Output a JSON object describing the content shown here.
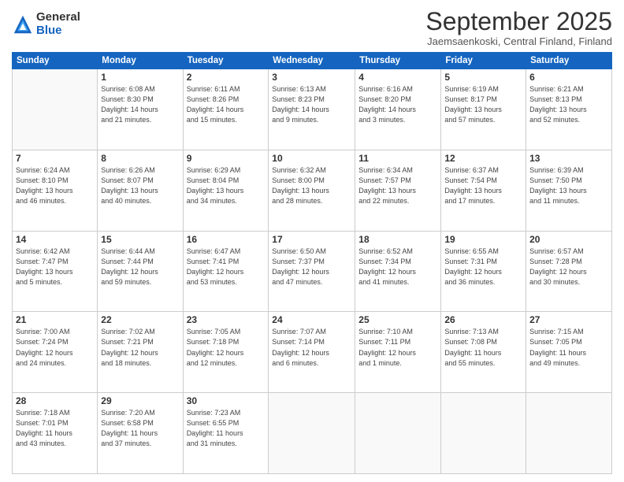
{
  "logo": {
    "general": "General",
    "blue": "Blue"
  },
  "header": {
    "month": "September 2025",
    "location": "Jaemsaenkoski, Central Finland, Finland"
  },
  "weekdays": [
    "Sunday",
    "Monday",
    "Tuesday",
    "Wednesday",
    "Thursday",
    "Friday",
    "Saturday"
  ],
  "weeks": [
    [
      {
        "day": "",
        "info": ""
      },
      {
        "day": "1",
        "info": "Sunrise: 6:08 AM\nSunset: 8:30 PM\nDaylight: 14 hours\nand 21 minutes."
      },
      {
        "day": "2",
        "info": "Sunrise: 6:11 AM\nSunset: 8:26 PM\nDaylight: 14 hours\nand 15 minutes."
      },
      {
        "day": "3",
        "info": "Sunrise: 6:13 AM\nSunset: 8:23 PM\nDaylight: 14 hours\nand 9 minutes."
      },
      {
        "day": "4",
        "info": "Sunrise: 6:16 AM\nSunset: 8:20 PM\nDaylight: 14 hours\nand 3 minutes."
      },
      {
        "day": "5",
        "info": "Sunrise: 6:19 AM\nSunset: 8:17 PM\nDaylight: 13 hours\nand 57 minutes."
      },
      {
        "day": "6",
        "info": "Sunrise: 6:21 AM\nSunset: 8:13 PM\nDaylight: 13 hours\nand 52 minutes."
      }
    ],
    [
      {
        "day": "7",
        "info": "Sunrise: 6:24 AM\nSunset: 8:10 PM\nDaylight: 13 hours\nand 46 minutes."
      },
      {
        "day": "8",
        "info": "Sunrise: 6:26 AM\nSunset: 8:07 PM\nDaylight: 13 hours\nand 40 minutes."
      },
      {
        "day": "9",
        "info": "Sunrise: 6:29 AM\nSunset: 8:04 PM\nDaylight: 13 hours\nand 34 minutes."
      },
      {
        "day": "10",
        "info": "Sunrise: 6:32 AM\nSunset: 8:00 PM\nDaylight: 13 hours\nand 28 minutes."
      },
      {
        "day": "11",
        "info": "Sunrise: 6:34 AM\nSunset: 7:57 PM\nDaylight: 13 hours\nand 22 minutes."
      },
      {
        "day": "12",
        "info": "Sunrise: 6:37 AM\nSunset: 7:54 PM\nDaylight: 13 hours\nand 17 minutes."
      },
      {
        "day": "13",
        "info": "Sunrise: 6:39 AM\nSunset: 7:50 PM\nDaylight: 13 hours\nand 11 minutes."
      }
    ],
    [
      {
        "day": "14",
        "info": "Sunrise: 6:42 AM\nSunset: 7:47 PM\nDaylight: 13 hours\nand 5 minutes."
      },
      {
        "day": "15",
        "info": "Sunrise: 6:44 AM\nSunset: 7:44 PM\nDaylight: 12 hours\nand 59 minutes."
      },
      {
        "day": "16",
        "info": "Sunrise: 6:47 AM\nSunset: 7:41 PM\nDaylight: 12 hours\nand 53 minutes."
      },
      {
        "day": "17",
        "info": "Sunrise: 6:50 AM\nSunset: 7:37 PM\nDaylight: 12 hours\nand 47 minutes."
      },
      {
        "day": "18",
        "info": "Sunrise: 6:52 AM\nSunset: 7:34 PM\nDaylight: 12 hours\nand 41 minutes."
      },
      {
        "day": "19",
        "info": "Sunrise: 6:55 AM\nSunset: 7:31 PM\nDaylight: 12 hours\nand 36 minutes."
      },
      {
        "day": "20",
        "info": "Sunrise: 6:57 AM\nSunset: 7:28 PM\nDaylight: 12 hours\nand 30 minutes."
      }
    ],
    [
      {
        "day": "21",
        "info": "Sunrise: 7:00 AM\nSunset: 7:24 PM\nDaylight: 12 hours\nand 24 minutes."
      },
      {
        "day": "22",
        "info": "Sunrise: 7:02 AM\nSunset: 7:21 PM\nDaylight: 12 hours\nand 18 minutes."
      },
      {
        "day": "23",
        "info": "Sunrise: 7:05 AM\nSunset: 7:18 PM\nDaylight: 12 hours\nand 12 minutes."
      },
      {
        "day": "24",
        "info": "Sunrise: 7:07 AM\nSunset: 7:14 PM\nDaylight: 12 hours\nand 6 minutes."
      },
      {
        "day": "25",
        "info": "Sunrise: 7:10 AM\nSunset: 7:11 PM\nDaylight: 12 hours\nand 1 minute."
      },
      {
        "day": "26",
        "info": "Sunrise: 7:13 AM\nSunset: 7:08 PM\nDaylight: 11 hours\nand 55 minutes."
      },
      {
        "day": "27",
        "info": "Sunrise: 7:15 AM\nSunset: 7:05 PM\nDaylight: 11 hours\nand 49 minutes."
      }
    ],
    [
      {
        "day": "28",
        "info": "Sunrise: 7:18 AM\nSunset: 7:01 PM\nDaylight: 11 hours\nand 43 minutes."
      },
      {
        "day": "29",
        "info": "Sunrise: 7:20 AM\nSunset: 6:58 PM\nDaylight: 11 hours\nand 37 minutes."
      },
      {
        "day": "30",
        "info": "Sunrise: 7:23 AM\nSunset: 6:55 PM\nDaylight: 11 hours\nand 31 minutes."
      },
      {
        "day": "",
        "info": ""
      },
      {
        "day": "",
        "info": ""
      },
      {
        "day": "",
        "info": ""
      },
      {
        "day": "",
        "info": ""
      }
    ]
  ]
}
